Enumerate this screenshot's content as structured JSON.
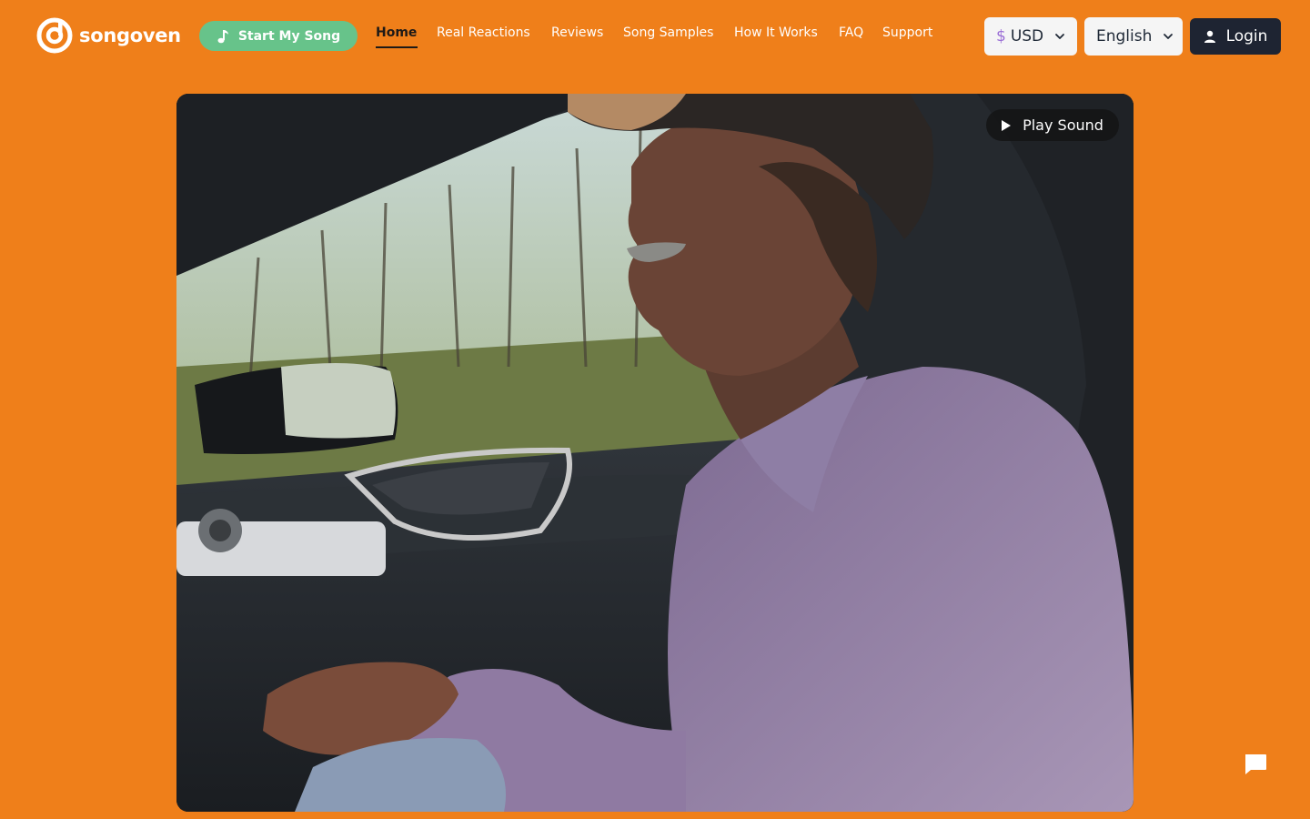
{
  "brand": {
    "name": "songoven",
    "logo_icon": "songoven-disc-logo-icon"
  },
  "header": {
    "cta_label": "Start My Song",
    "cta_icon": "music-note-icon",
    "nav": [
      {
        "label": "Home",
        "active": true
      },
      {
        "label": "Real Reactions",
        "active": false
      },
      {
        "label": "Reviews",
        "active": false
      },
      {
        "label": "Song Samples",
        "active": false
      },
      {
        "label": "How It Works",
        "active": false
      },
      {
        "label": "FAQ",
        "active": false
      },
      {
        "label": "Support",
        "active": false
      }
    ],
    "currency": {
      "symbol": "$",
      "value": "USD"
    },
    "language": {
      "value": "English"
    },
    "login_label": "Login"
  },
  "video": {
    "play_sound_label": "Play Sound",
    "play_icon": "play-icon"
  },
  "chat": {
    "icon": "chat-bubble-icon"
  },
  "colors": {
    "background": "#ef7f1a",
    "cta": "#67c38a",
    "login": "#1e2432",
    "text_dark": "#1e1a17"
  }
}
